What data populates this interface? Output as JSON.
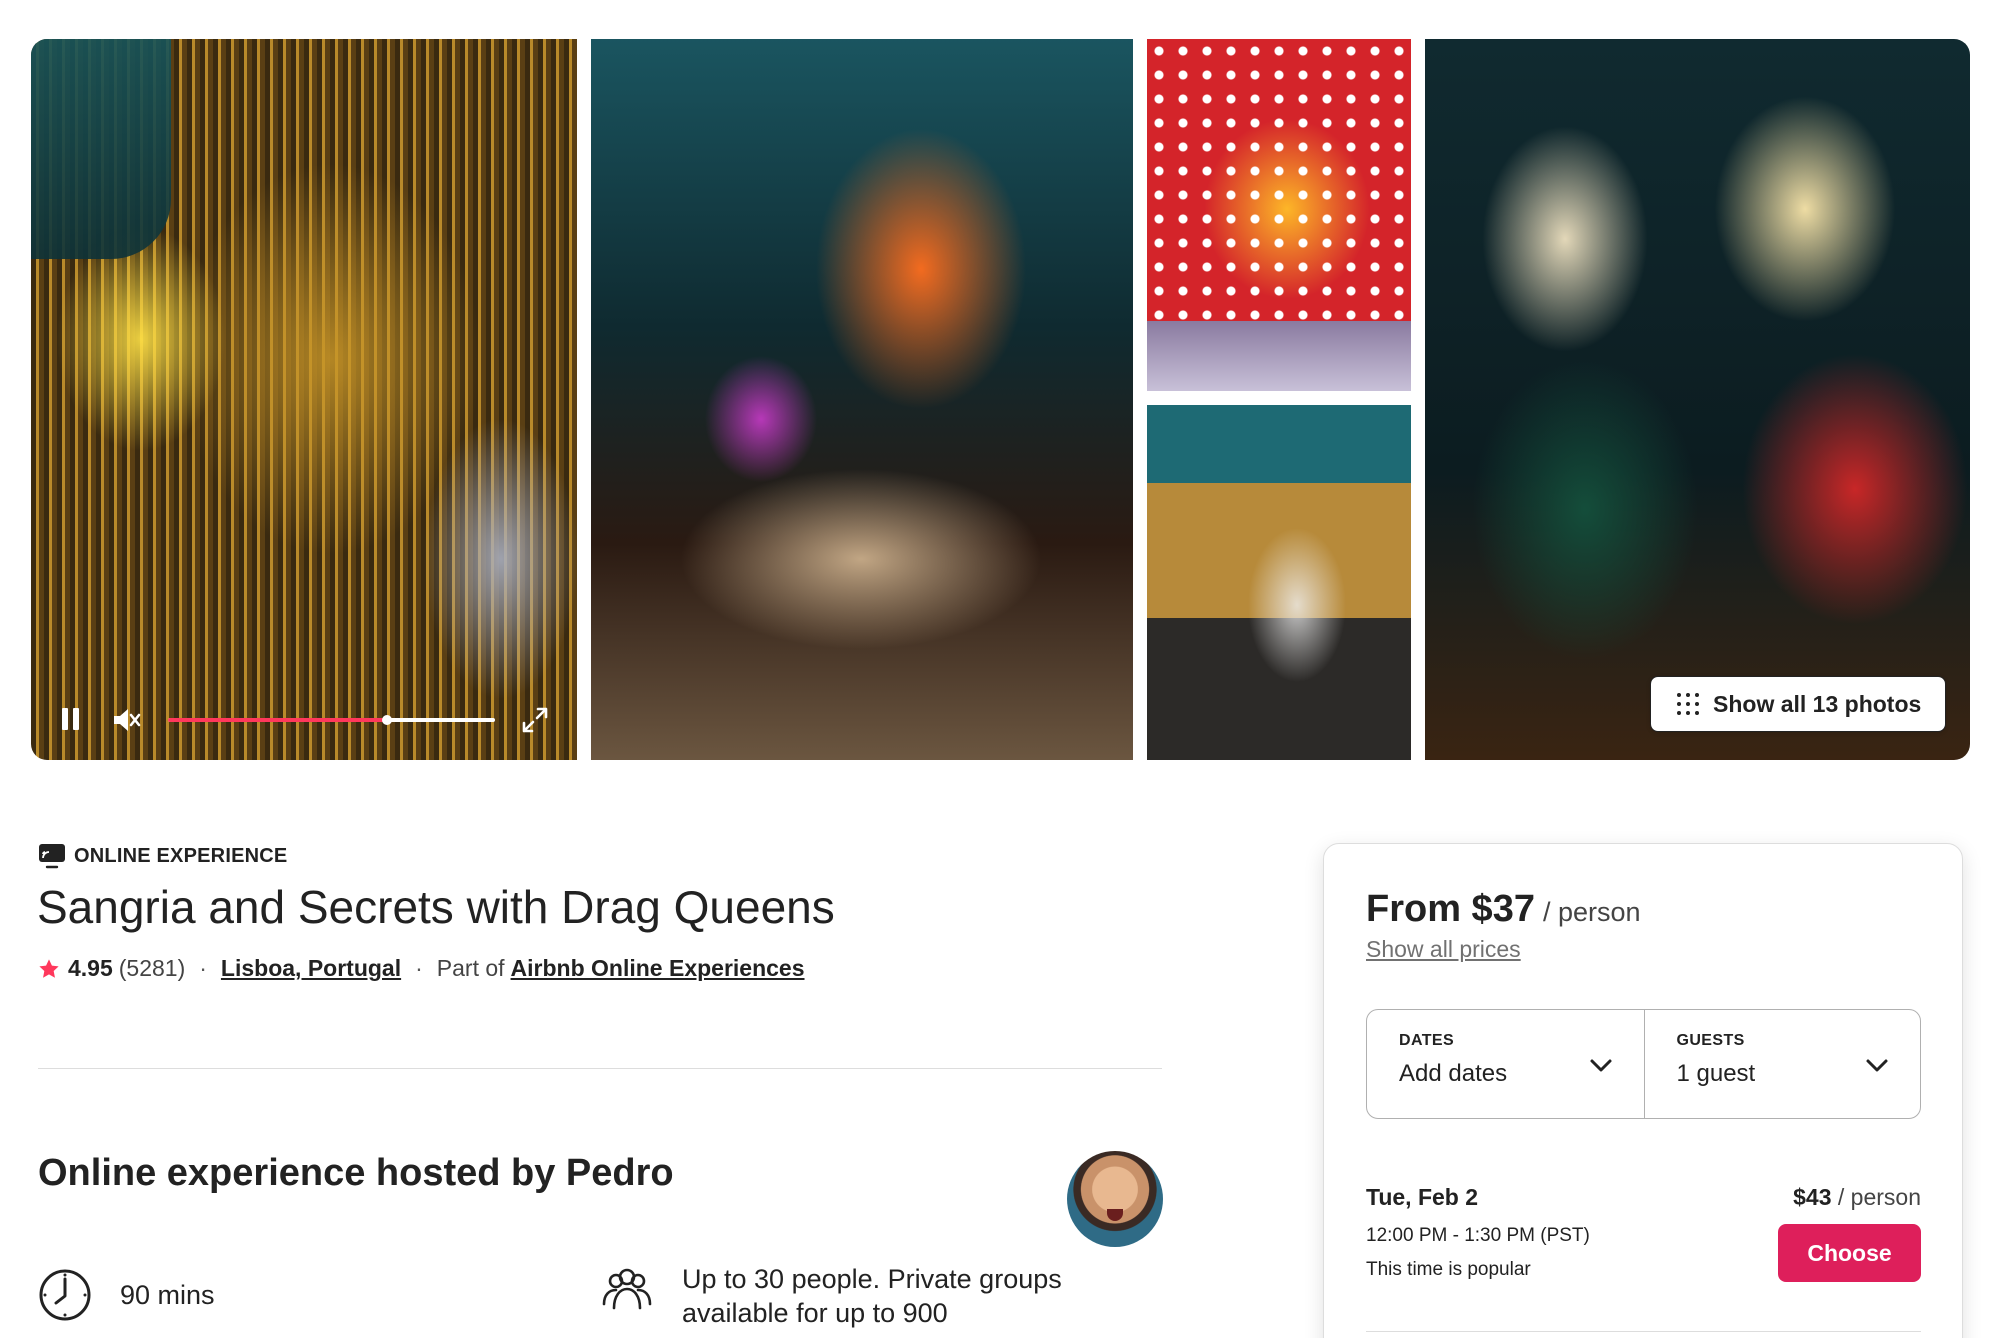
{
  "gallery": {
    "photos": [
      "video",
      "party",
      "sangria",
      "queens",
      "cooking"
    ],
    "video": {
      "progress": 0.67
    },
    "show_all_label": "Show all 13 photos"
  },
  "listing": {
    "category": "ONLINE EXPERIENCE",
    "title": "Sangria and Secrets with Drag Queens",
    "rating": "4.95",
    "reviews": "(5281)",
    "separator": "·",
    "location": "Lisboa, Portugal",
    "part_of_prefix": "Part of",
    "part_of_link": "Airbnb Online Experiences"
  },
  "host": {
    "title": "Online experience hosted by Pedro"
  },
  "features": {
    "duration": "90 mins",
    "group": "Up to 30 people. Private groups available for up to 900"
  },
  "booking": {
    "price": "From $37",
    "price_unit": "/ person",
    "show_prices": "Show all prices",
    "dates_label": "DATES",
    "dates_value": "Add dates",
    "guests_label": "GUESTS",
    "guests_value": "1 guest",
    "slot": {
      "date": "Tue, Feb 2",
      "time": "12:00 PM - 1:30 PM (PST)",
      "note": "This time is popular",
      "price": "$43",
      "price_unit": "/ person",
      "choose_label": "Choose"
    }
  },
  "colors": {
    "brand": "#ff385c",
    "choose_button": "#de1f5b",
    "text": "#222222",
    "muted": "#717171"
  },
  "icons": {
    "category": "online-tv-icon",
    "rating": "star-icon",
    "duration": "clock-icon",
    "group": "people-icon",
    "picker": "chevron-down-icon",
    "gallery": "grid-dots-icon"
  }
}
